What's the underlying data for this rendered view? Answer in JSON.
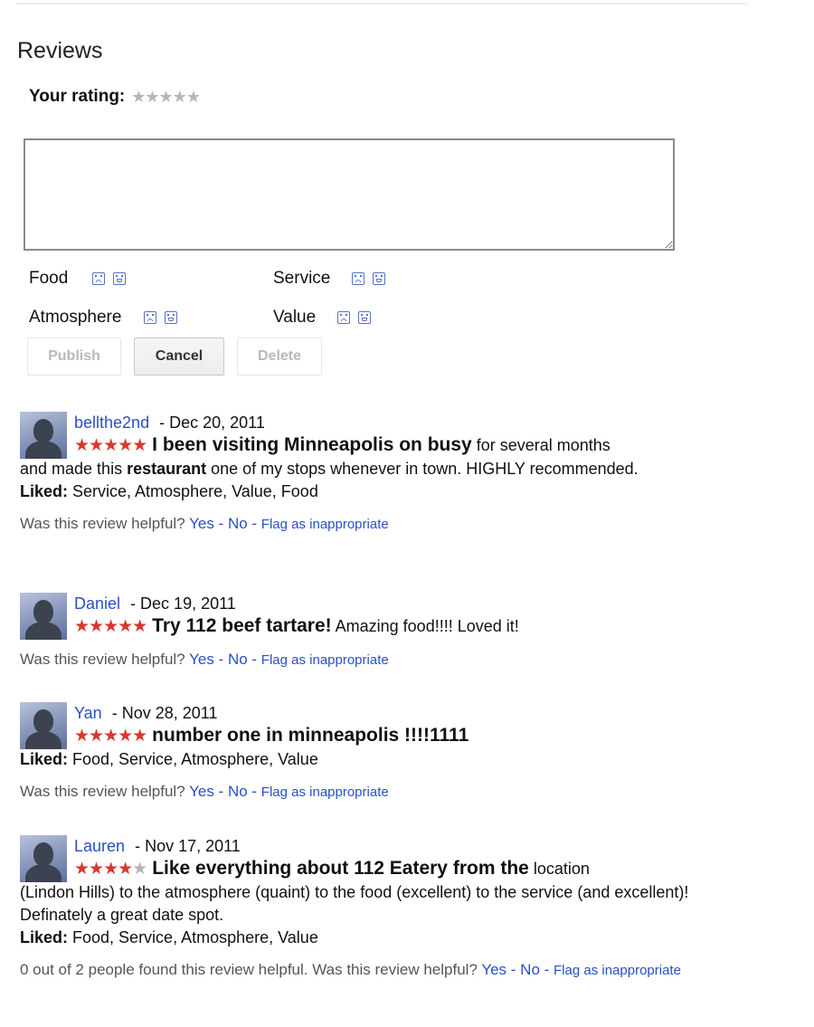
{
  "section": {
    "heading": "Reviews",
    "your_rating_label": "Your rating:",
    "your_rating_stars": "★★★★★",
    "your_rating_value": 0,
    "review_text_value": "",
    "categories": [
      {
        "label": "Food"
      },
      {
        "label": "Service"
      },
      {
        "label": "Atmosphere"
      },
      {
        "label": "Value"
      }
    ],
    "buttons": {
      "publish": "Publish",
      "cancel": "Cancel",
      "delete": "Delete"
    }
  },
  "colors": {
    "link": "#2a4fc3",
    "star_on": "#d9372f",
    "star_off": "#b5b5b5",
    "face_icon": "#5872c4"
  },
  "reviews": [
    {
      "author": "bellthe2nd",
      "date": "- Dec 20, 2011",
      "rating": 5,
      "stars_on": "★★★★★",
      "stars_off": "",
      "title": "I been visiting Minneapolis on busy",
      "snippet": " for several months",
      "body_pre": "and made this ",
      "body_bold": "restaurant",
      "body_post": " one of my stops whenever in town. HIGHLY recommended.",
      "liked_label": "Liked:",
      "liked": " Service, Atmosphere, Value, Food",
      "helpful_count": "",
      "helpful_q": "Was this review helpful?",
      "yes": "Yes",
      "no": "No",
      "flag": "Flag as inappropriate"
    },
    {
      "author": "Daniel",
      "date": "- Dec 19, 2011",
      "rating": 5,
      "stars_on": "★★★★★",
      "stars_off": "",
      "title": "Try 112 beef tartare!",
      "snippet": " Amazing food!!!! Loved it!",
      "helpful_q": "Was this review helpful?",
      "yes": "Yes",
      "no": "No",
      "flag": "Flag as inappropriate"
    },
    {
      "author": "Yan",
      "date": "- Nov 28, 2011",
      "rating": 5,
      "stars_on": "★★★★★",
      "stars_off": "",
      "title": "number one in minneapolis !!!!1111",
      "snippet": "",
      "liked_label": "Liked:",
      "liked": " Food, Service, Atmosphere, Value",
      "helpful_q": "Was this review helpful?",
      "yes": "Yes",
      "no": "No",
      "flag": "Flag as inappropriate"
    },
    {
      "author": "Lauren",
      "date": "- Nov 17, 2011",
      "rating": 4,
      "stars_on": "★★★★",
      "stars_off": "★",
      "title": "Like everything about 112 Eatery from the",
      "snippet": " location",
      "body": "(Lindon Hills) to the atmosphere (quaint) to the food (excellent) to the service (and excellent)! Definately a great date spot.",
      "liked_label": "Liked:",
      "liked": " Food, Service, Atmosphere, Value",
      "helpful_count": "0 out of 2 people found this review helpful.",
      "helpful_q": "Was this review helpful?",
      "yes": "Yes",
      "no": "No",
      "flag": "Flag as inappropriate"
    }
  ],
  "separators": {
    "dash": " - "
  }
}
